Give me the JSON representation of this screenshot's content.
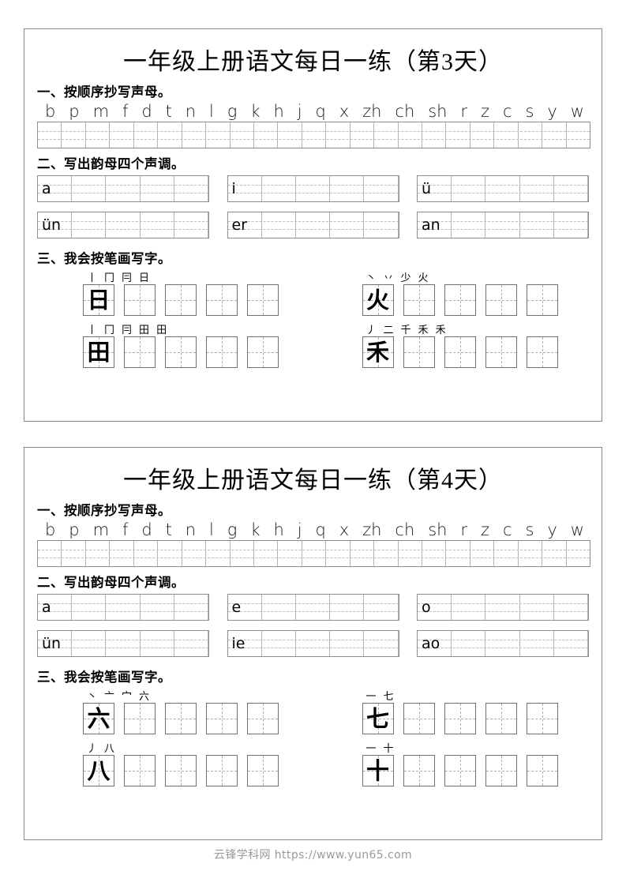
{
  "worksheets": [
    {
      "title": "一年级上册语文每日一练（第3天）",
      "sections": {
        "one": {
          "heading": "一、按顺序抄写声母。",
          "consonants": [
            "b",
            "p",
            "m",
            "f",
            "d",
            "t",
            "n",
            "l",
            "g",
            "k",
            "h",
            "j",
            "q",
            "x",
            "zh",
            "ch",
            "sh",
            "r",
            "z",
            "c",
            "s",
            "y",
            "w"
          ],
          "grid_cells": 23
        },
        "two": {
          "heading": "二、写出韵母四个声调。",
          "boxes": [
            {
              "label": "a",
              "cells": 5
            },
            {
              "label": "i",
              "cells": 5
            },
            {
              "label": "ü",
              "cells": 5
            },
            {
              "label": "ün",
              "cells": 5
            },
            {
              "label": "er",
              "cells": 5
            },
            {
              "label": "an",
              "cells": 5
            }
          ]
        },
        "three": {
          "heading": "三、我会按笔画写字。",
          "characters": [
            {
              "char": "日",
              "strokes": [
                "丨",
                "冂",
                "冃",
                "日"
              ],
              "boxes": 5
            },
            {
              "char": "火",
              "strokes": [
                "丶",
                "丷",
                "少",
                "火"
              ],
              "boxes": 5
            },
            {
              "char": "田",
              "strokes": [
                "丨",
                "冂",
                "冃",
                "田",
                "田"
              ],
              "boxes": 5
            },
            {
              "char": "禾",
              "strokes": [
                "丿",
                "二",
                "千",
                "禾",
                "禾"
              ],
              "boxes": 5
            }
          ]
        }
      }
    },
    {
      "title": "一年级上册语文每日一练（第4天）",
      "sections": {
        "one": {
          "heading": "一、按顺序抄写声母。",
          "consonants": [
            "b",
            "p",
            "m",
            "f",
            "d",
            "t",
            "n",
            "l",
            "g",
            "k",
            "h",
            "j",
            "q",
            "x",
            "zh",
            "ch",
            "sh",
            "r",
            "z",
            "c",
            "s",
            "y",
            "w"
          ],
          "grid_cells": 23
        },
        "two": {
          "heading": "二、写出韵母四个声调。",
          "boxes": [
            {
              "label": "a",
              "cells": 5
            },
            {
              "label": "e",
              "cells": 5
            },
            {
              "label": "o",
              "cells": 5
            },
            {
              "label": "ün",
              "cells": 5
            },
            {
              "label": "ie",
              "cells": 5
            },
            {
              "label": "ao",
              "cells": 5
            }
          ]
        },
        "three": {
          "heading": "三、我会按笔画写字。",
          "characters": [
            {
              "char": "六",
              "strokes": [
                "丶",
                "亠",
                "宀",
                "六"
              ],
              "boxes": 5
            },
            {
              "char": "七",
              "strokes": [
                "一",
                "七"
              ],
              "boxes": 5
            },
            {
              "char": "八",
              "strokes": [
                "丿",
                "八"
              ],
              "boxes": 5
            },
            {
              "char": "十",
              "strokes": [
                "一",
                "十"
              ],
              "boxes": 5
            }
          ]
        }
      }
    }
  ],
  "footer": {
    "text": "云锋学科网 https://www.yun65.com"
  },
  "colors": {
    "border": "#8a8a8a",
    "grid_line": "#b4b4b4",
    "dashed_line": "#bdbdbd",
    "text": "#000000",
    "footer_text": "#9a9a9a"
  }
}
